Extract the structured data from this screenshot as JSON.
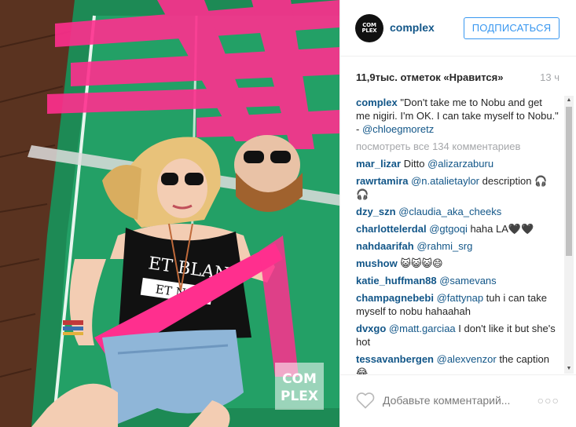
{
  "post": {
    "username": "complex",
    "avatar_text": "COM\nPLEX",
    "follow_label": "ПОДПИСАТЬСЯ",
    "likes": "11,9тыс. отметок «Нравится»",
    "time_ago": "13 ч",
    "photo_watermark_line1": "COM",
    "photo_watermark_line2": "PLEX",
    "shirt_text_1": "ET BLANC",
    "shirt_text_2": "ET NOIR"
  },
  "caption": {
    "user": "complex",
    "text": "\"Don't take me to Nobu and get me nigiri. I'm OK. I can take myself to Nobu.\" - ",
    "mention": "@chloegmoretz"
  },
  "view_all_label": "посмотреть все 134 комментариев",
  "comments": [
    {
      "user": "mar_lizar",
      "pre": "Ditto ",
      "mention": "@alizarzaburu",
      "post": ""
    },
    {
      "user": "rawrtamira",
      "pre": "",
      "mention": "@n.atalietaylor",
      "post": " description 🎧🎧"
    },
    {
      "user": "dzy_szn",
      "pre": "",
      "mention": "@claudia_aka_cheeks",
      "post": ""
    },
    {
      "user": "charlottelerdal",
      "pre": "",
      "mention": "@gtgoqi",
      "post": " haha LA🖤🖤"
    },
    {
      "user": "nahdaarifah",
      "pre": "",
      "mention": "@rahmi_srg",
      "post": ""
    },
    {
      "user": "mushow",
      "pre": "😺😺😺😄",
      "mention": "",
      "post": ""
    },
    {
      "user": "katie_huffman88",
      "pre": "",
      "mention": "@samevans",
      "post": ""
    },
    {
      "user": "champagnebebi",
      "pre": "",
      "mention": "@fattynap",
      "post": " tuh i can take myself to nobu hahaahah"
    },
    {
      "user": "dvxgo",
      "pre": "",
      "mention": "@matt.garciaa",
      "post": " I don't like it but she's hot"
    },
    {
      "user": "tessavanbergen",
      "pre": "",
      "mention": "@alexvenzor",
      "post": " the caption 😂"
    }
  ],
  "footer": {
    "add_comment_placeholder": "Добавьте комментарий...",
    "more_label": "○○○"
  },
  "colors": {
    "accent": "#3897f0",
    "username": "#125688",
    "muted": "#a5a7aa"
  }
}
